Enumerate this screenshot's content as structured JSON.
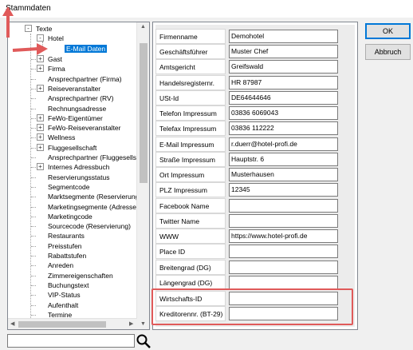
{
  "window": {
    "title": "Stammdaten"
  },
  "tree": {
    "root_label": "Texte",
    "hotel_label": "Hotel",
    "selected_label": "E-Mail Daten",
    "items": [
      "Gast",
      "Firma",
      "Ansprechpartner (Firma)",
      "Reiseveranstalter",
      "Ansprechpartner (RV)",
      "Rechnungsadresse",
      "FeWo-Eigentümer",
      "FeWo-Reiseveranstalter",
      "Wellness",
      "Fluggesellschaft",
      "Ansprechpartner (Fluggesellsc",
      "Internes Adressbuch",
      "Reservierungsstatus",
      "Segmentcode",
      "Marktsegmente (Reservierung",
      "Marketingsegmente (Adresse)",
      "Marketingcode",
      "Sourcecode (Reservierung)",
      "Restaurants",
      "Preisstufen",
      "Rabattstufen",
      "Anreden",
      "Zimmereigenschaften",
      "Buchungstext",
      "VIP-Status",
      "Aufenthalt",
      "Termine"
    ]
  },
  "search": {
    "value": "",
    "icon": "magnifier-icon"
  },
  "form": {
    "fields": [
      {
        "label": "Firmenname",
        "value": "Demohotel"
      },
      {
        "label": "Geschäftsführer",
        "value": "Muster Chef"
      },
      {
        "label": "Amtsgericht",
        "value": "Greifswald"
      },
      {
        "label": "Handelsregisternr.",
        "value": "HR 87987"
      },
      {
        "label": "USt-Id",
        "value": "DE64644646"
      },
      {
        "label": "Telefon Impressum",
        "value": "03836 6069043"
      },
      {
        "label": "Telefax Impressum",
        "value": "03836 112222"
      },
      {
        "label": "E-Mail Impressum",
        "value": "r.duerr@hotel-profi.de"
      },
      {
        "label": "Straße Impressum",
        "value": "Hauptstr. 6"
      },
      {
        "label": "Ort Impressum",
        "value": "Musterhausen"
      },
      {
        "label": "PLZ Impressum",
        "value": "12345"
      },
      {
        "label": "Facebook Name",
        "value": ""
      },
      {
        "label": "Twitter Name",
        "value": ""
      },
      {
        "label": "WWW",
        "value": "https://www.hotel-profi.de"
      },
      {
        "label": "Place ID",
        "value": ""
      },
      {
        "label": "Breitengrad (DG)",
        "value": ""
      },
      {
        "label": "Längengrad (DG)",
        "value": ""
      },
      {
        "label": "Wirtschafts-ID",
        "value": ""
      },
      {
        "label": "Kreditorennr. (BT-29)",
        "value": ""
      }
    ]
  },
  "buttons": {
    "ok_label": "OK",
    "cancel_label": "Abbruch"
  },
  "colors": {
    "selection": "#0078d7",
    "annotation": "#e05a5a"
  }
}
